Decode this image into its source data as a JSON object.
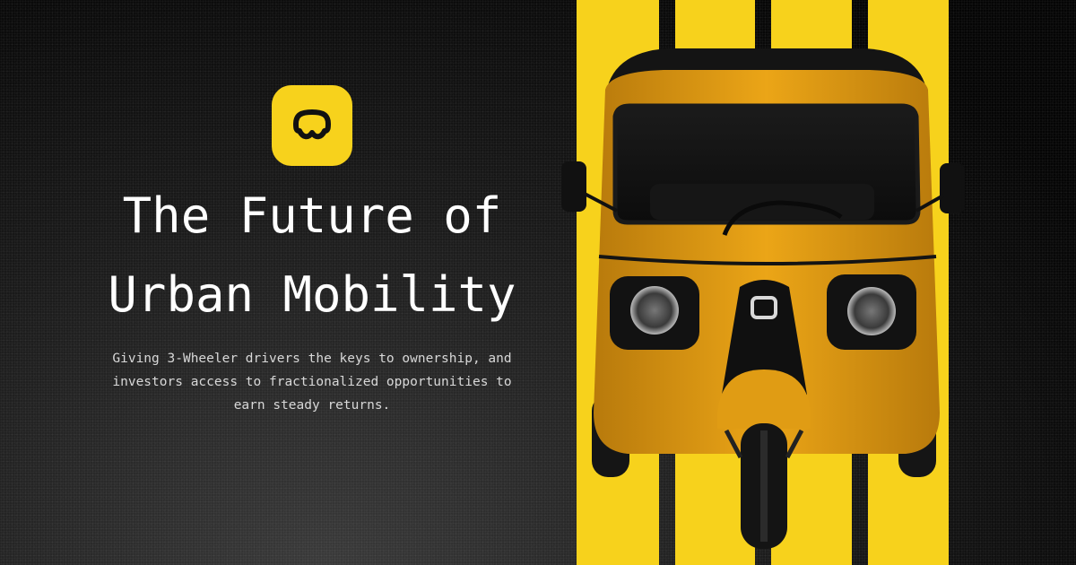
{
  "hero": {
    "headline_line1": "The Future of",
    "headline_line2": "Urban Mobility",
    "subtitle": "Giving 3-Wheeler drivers the keys to ownership, and investors access to fractionalized opportunities to earn steady returns."
  },
  "logo": {
    "icon": "brand-logo-icon"
  },
  "image": {
    "subject": "rickshaw-image"
  },
  "colors": {
    "accent": "#f7d21c",
    "background": "#050505",
    "vehicle": "#e8a214"
  }
}
